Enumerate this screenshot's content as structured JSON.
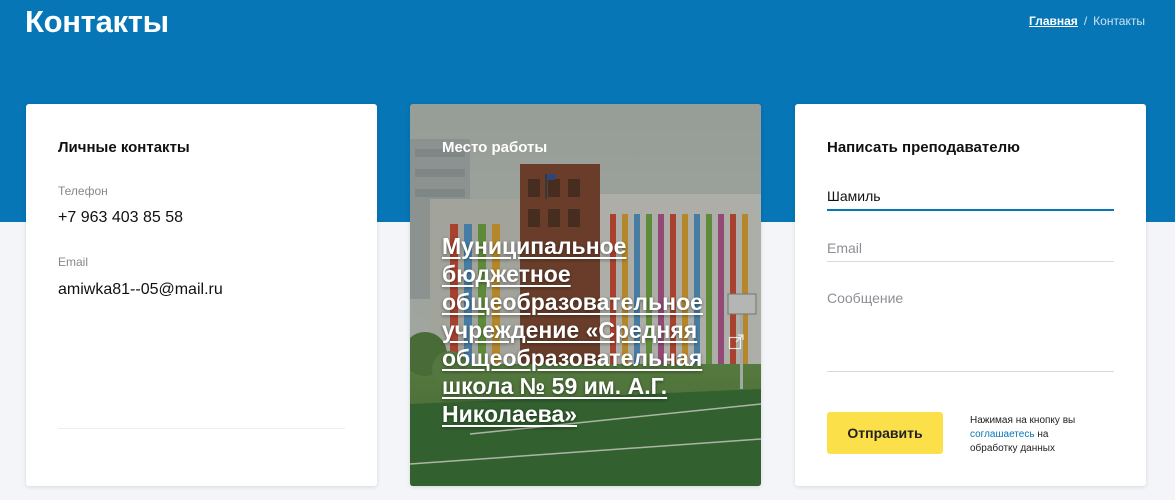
{
  "header": {
    "title": "Контакты",
    "breadcrumb": {
      "home": "Главная",
      "separator": "/",
      "current": "Контакты"
    }
  },
  "personal": {
    "heading": "Личные контакты",
    "phone_label": "Телефон",
    "phone": "+7 963 403 85 58",
    "email_label": "Email",
    "email": "amiwka81--05@mail.ru"
  },
  "workplace": {
    "label": "Место работы",
    "name": "Муниципальное бюджетное общеобразовательное учреждение «Средняя общеобразовательная школа № 59 им. А.Г. Николаева»",
    "icon": "external-link-icon"
  },
  "message_form": {
    "heading": "Написать преподавателю",
    "name_value": "Шамиль",
    "email_placeholder": "Email",
    "message_placeholder": "Сообщение",
    "submit_label": "Отправить",
    "consent_before": "Нажимая на кнопку вы ",
    "consent_link": "соглашаетесь",
    "consent_after": " на обработку данных"
  },
  "colors": {
    "header_blue": "#0676b7",
    "button_yellow": "#fbe04a",
    "link_blue": "#0676b7"
  }
}
